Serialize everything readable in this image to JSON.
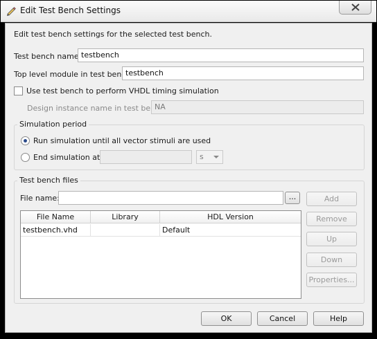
{
  "window": {
    "title": "Edit Test Bench Settings",
    "icon": "pencil-icon",
    "close_icon": "close-icon"
  },
  "intro": "Edit test bench settings for the selected test bench.",
  "test_bench_name": {
    "label": "Test bench name:",
    "value": "testbench"
  },
  "top_level_module": {
    "label": "Top level module in test bench:",
    "value": "testbench"
  },
  "vhdl_timing": {
    "label": "Use test bench to perform VHDL timing simulation",
    "checked": false
  },
  "design_instance": {
    "label": "Design instance name in test bench:",
    "value": "NA"
  },
  "simulation_period": {
    "title": "Simulation period",
    "run_all_label": "Run simulation until all vector stimuli are used",
    "run_all_selected": true,
    "end_at_label": "End simulation at:",
    "end_at_value": "",
    "unit": "s"
  },
  "files": {
    "title": "Test bench files",
    "file_name_label": "File name:",
    "file_name_value": "",
    "browse_label": "...",
    "columns": [
      "File Name",
      "Library",
      "HDL Version"
    ],
    "rows": [
      {
        "file": "testbench.vhd",
        "library": "",
        "hdl": "Default"
      }
    ],
    "buttons": {
      "add": "Add",
      "remove": "Remove",
      "up": "Up",
      "down": "Down",
      "properties": "Properties..."
    }
  },
  "footer": {
    "ok": "OK",
    "cancel": "Cancel",
    "help": "Help"
  }
}
